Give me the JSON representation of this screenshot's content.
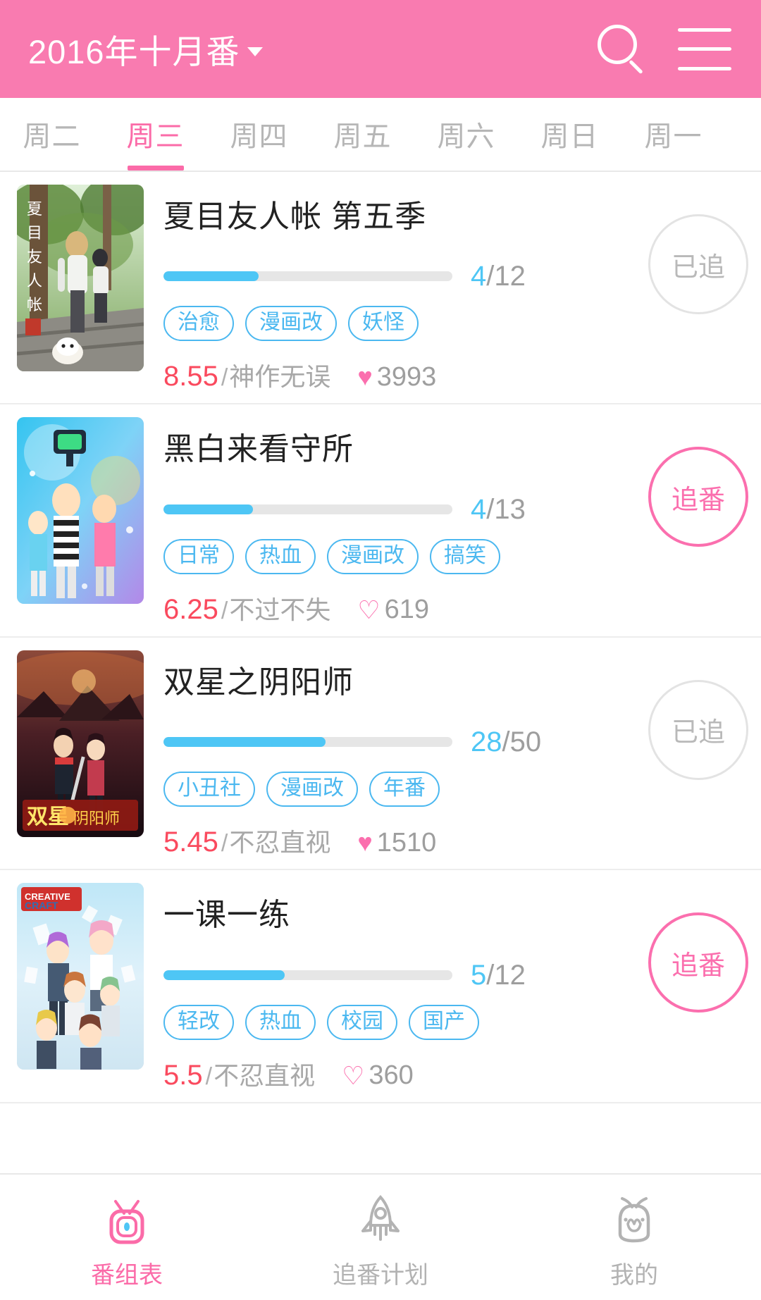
{
  "header": {
    "title": "2016年十月番",
    "caret": "▾",
    "search_icon": "search-icon",
    "menu_icon": "hamburger-menu-icon"
  },
  "tabs": {
    "items": [
      {
        "label": "周二",
        "active": false
      },
      {
        "label": "周三",
        "active": true
      },
      {
        "label": "周四",
        "active": false
      },
      {
        "label": "周五",
        "active": false
      },
      {
        "label": "周六",
        "active": false
      },
      {
        "label": "周日",
        "active": false
      },
      {
        "label": "周一",
        "active": false
      }
    ]
  },
  "anime": [
    {
      "title": "夏目友人帐 第五季",
      "current_ep": "4",
      "total_ep": "12",
      "separator": "/",
      "progress_pct": 33,
      "tags": [
        "治愈",
        "漫画改",
        "妖怪"
      ],
      "score": "8.55",
      "score_sep": "/",
      "score_label": "神作无误",
      "likes": "3993",
      "heart": "♥",
      "heart_filled": true,
      "button_label": "已追",
      "button_state": "done"
    },
    {
      "title": "黑白来看守所",
      "current_ep": "4",
      "total_ep": "13",
      "separator": "/",
      "progress_pct": 31,
      "tags": [
        "日常",
        "热血",
        "漫画改",
        "搞笑"
      ],
      "score": "6.25",
      "score_sep": "/",
      "score_label": "不过不失",
      "likes": "619",
      "heart": "♡",
      "heart_filled": false,
      "button_label": "追番",
      "button_state": "todo"
    },
    {
      "title": "双星之阴阳师",
      "current_ep": "28",
      "total_ep": "50",
      "separator": "/",
      "progress_pct": 56,
      "tags": [
        "小丑社",
        "漫画改",
        "年番"
      ],
      "score": "5.45",
      "score_sep": "/",
      "score_label": "不忍直视",
      "likes": "1510",
      "heart": "♥",
      "heart_filled": true,
      "button_label": "已追",
      "button_state": "done"
    },
    {
      "title": "一课一练",
      "current_ep": "5",
      "total_ep": "12",
      "separator": "/",
      "progress_pct": 42,
      "tags": [
        "轻改",
        "热血",
        "校园",
        "国产"
      ],
      "score": "5.5",
      "score_sep": "/",
      "score_label": "不忍直视",
      "likes": "360",
      "heart": "♡",
      "heart_filled": false,
      "button_label": "追番",
      "button_state": "todo"
    }
  ],
  "bottomnav": {
    "items": [
      {
        "label": "番组表",
        "icon": "tv-icon",
        "active": true
      },
      {
        "label": "追番计划",
        "icon": "rocket-icon",
        "active": false
      },
      {
        "label": "我的",
        "icon": "character-head-icon",
        "active": false
      }
    ]
  },
  "colors": {
    "brand_pink": "#f97bb0",
    "accent_pink": "#fb6ba8",
    "progress_blue": "#4ec6f5",
    "tag_blue": "#4bb8f0",
    "score_red": "#fa4a5e"
  }
}
